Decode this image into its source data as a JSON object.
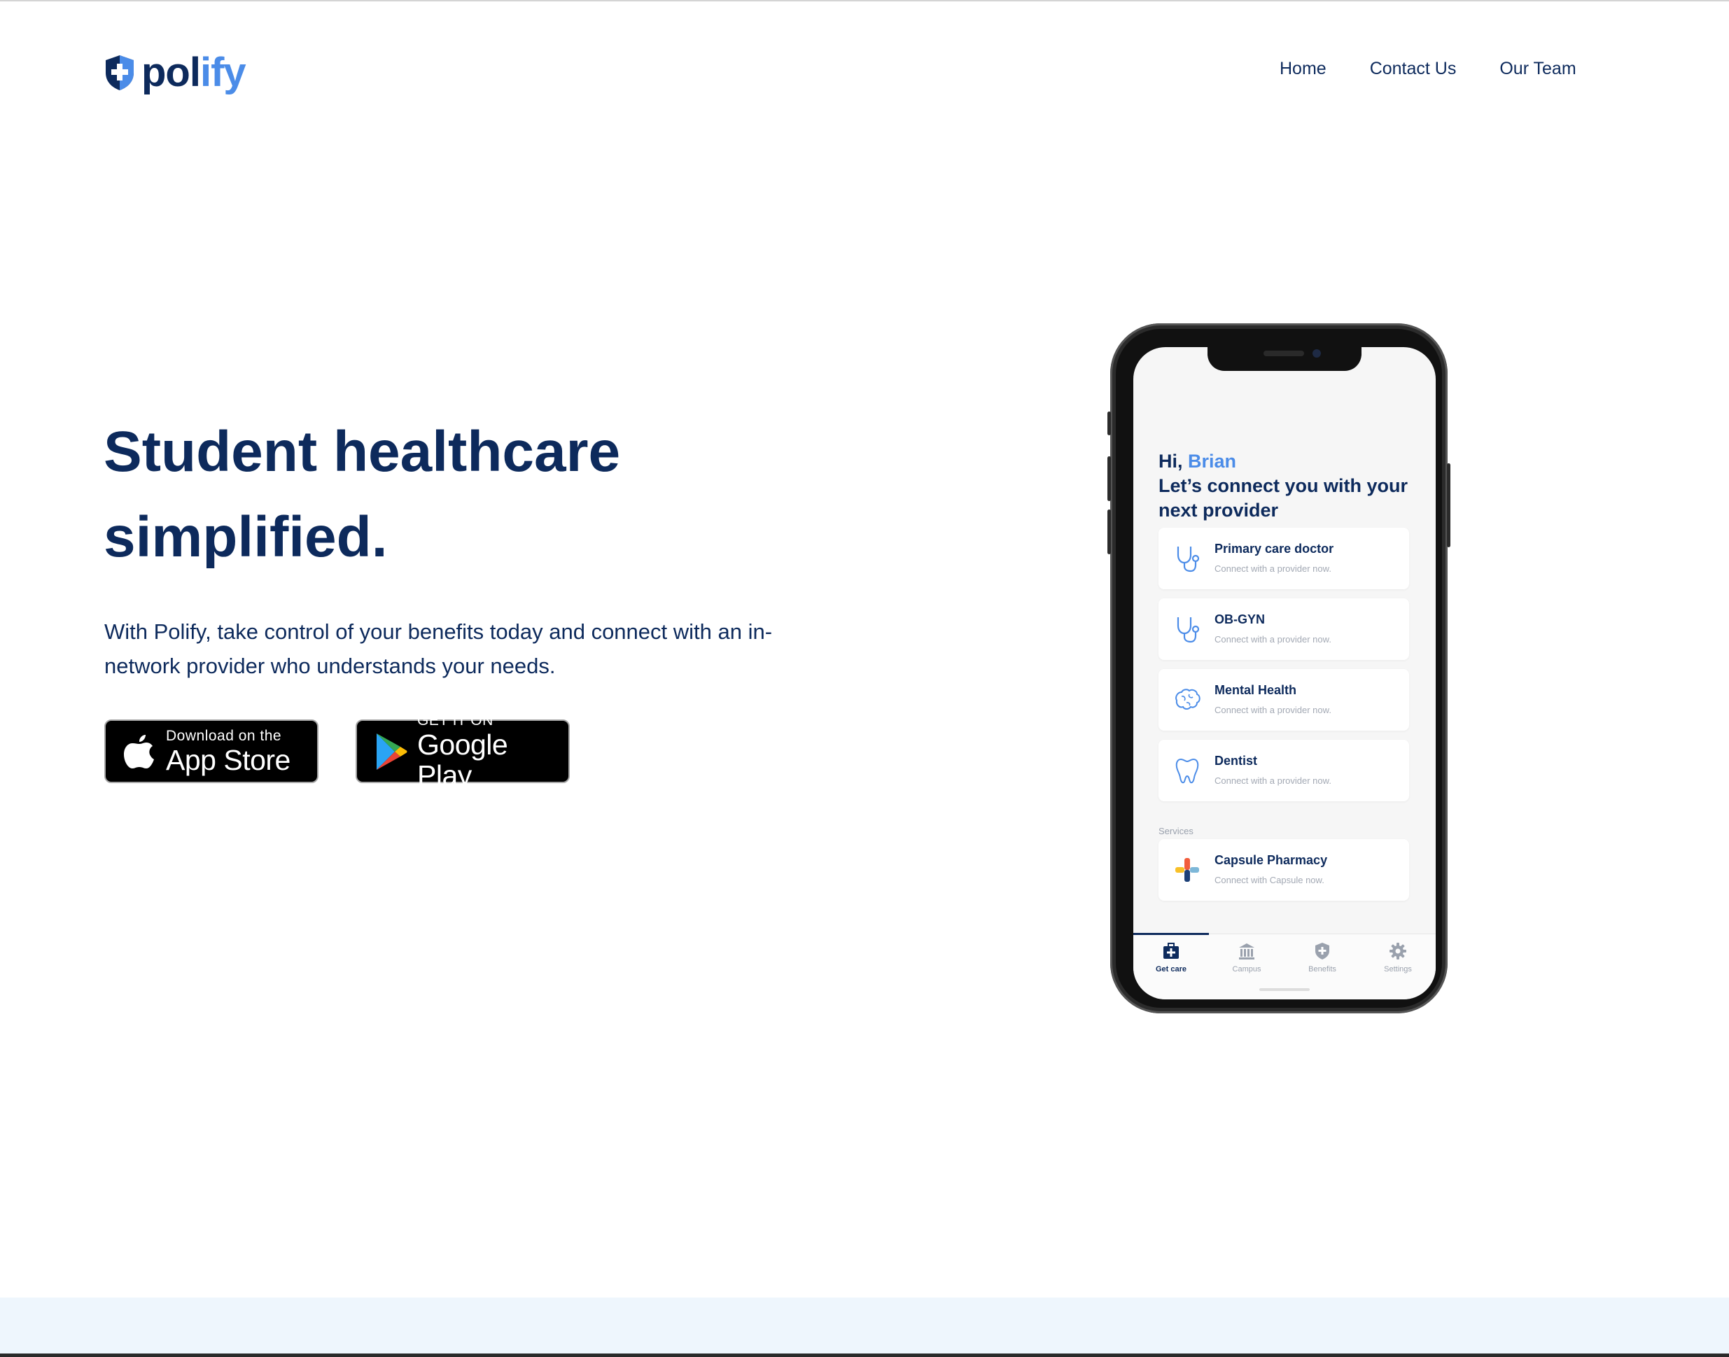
{
  "brand": {
    "name_part1": "pol",
    "name_part2": "ify",
    "primary_color": "#0d2a5c",
    "accent_color": "#4b8ce8"
  },
  "nav": {
    "items": [
      "Home",
      "Contact Us",
      "Our Team"
    ]
  },
  "hero": {
    "title": "Student healthcare simplified.",
    "subtitle": "With Polify, take control of your benefits today and connect with an in-network provider who understands your needs."
  },
  "app_store": {
    "small": "Download on the",
    "big": "App Store"
  },
  "google_play": {
    "small": "GET IT ON",
    "big": "Google Play"
  },
  "phone": {
    "greeting_hi": "Hi,",
    "greeting_name": "Brian",
    "greeting_line2": "Let’s connect you with your next provider",
    "providers": [
      {
        "title": "Primary care doctor",
        "subtitle": "Connect with a provider now.",
        "icon": "stethoscope-icon"
      },
      {
        "title": "OB-GYN",
        "subtitle": "Connect with a provider now.",
        "icon": "stethoscope-icon"
      },
      {
        "title": "Mental Health",
        "subtitle": "Connect with a provider now.",
        "icon": "brain-icon"
      },
      {
        "title": "Dentist",
        "subtitle": "Connect with a provider now.",
        "icon": "tooth-icon"
      }
    ],
    "services_label": "Services",
    "services": [
      {
        "title": "Capsule Pharmacy",
        "subtitle": "Connect with Capsule now.",
        "icon": "pharmacy-plus-icon"
      }
    ],
    "tabs": [
      {
        "label": "Get care",
        "icon": "medkit-icon",
        "active": true
      },
      {
        "label": "Campus",
        "icon": "building-icon",
        "active": false
      },
      {
        "label": "Benefits",
        "icon": "shield-icon",
        "active": false
      },
      {
        "label": "Settings",
        "icon": "gear-icon",
        "active": false
      }
    ]
  }
}
